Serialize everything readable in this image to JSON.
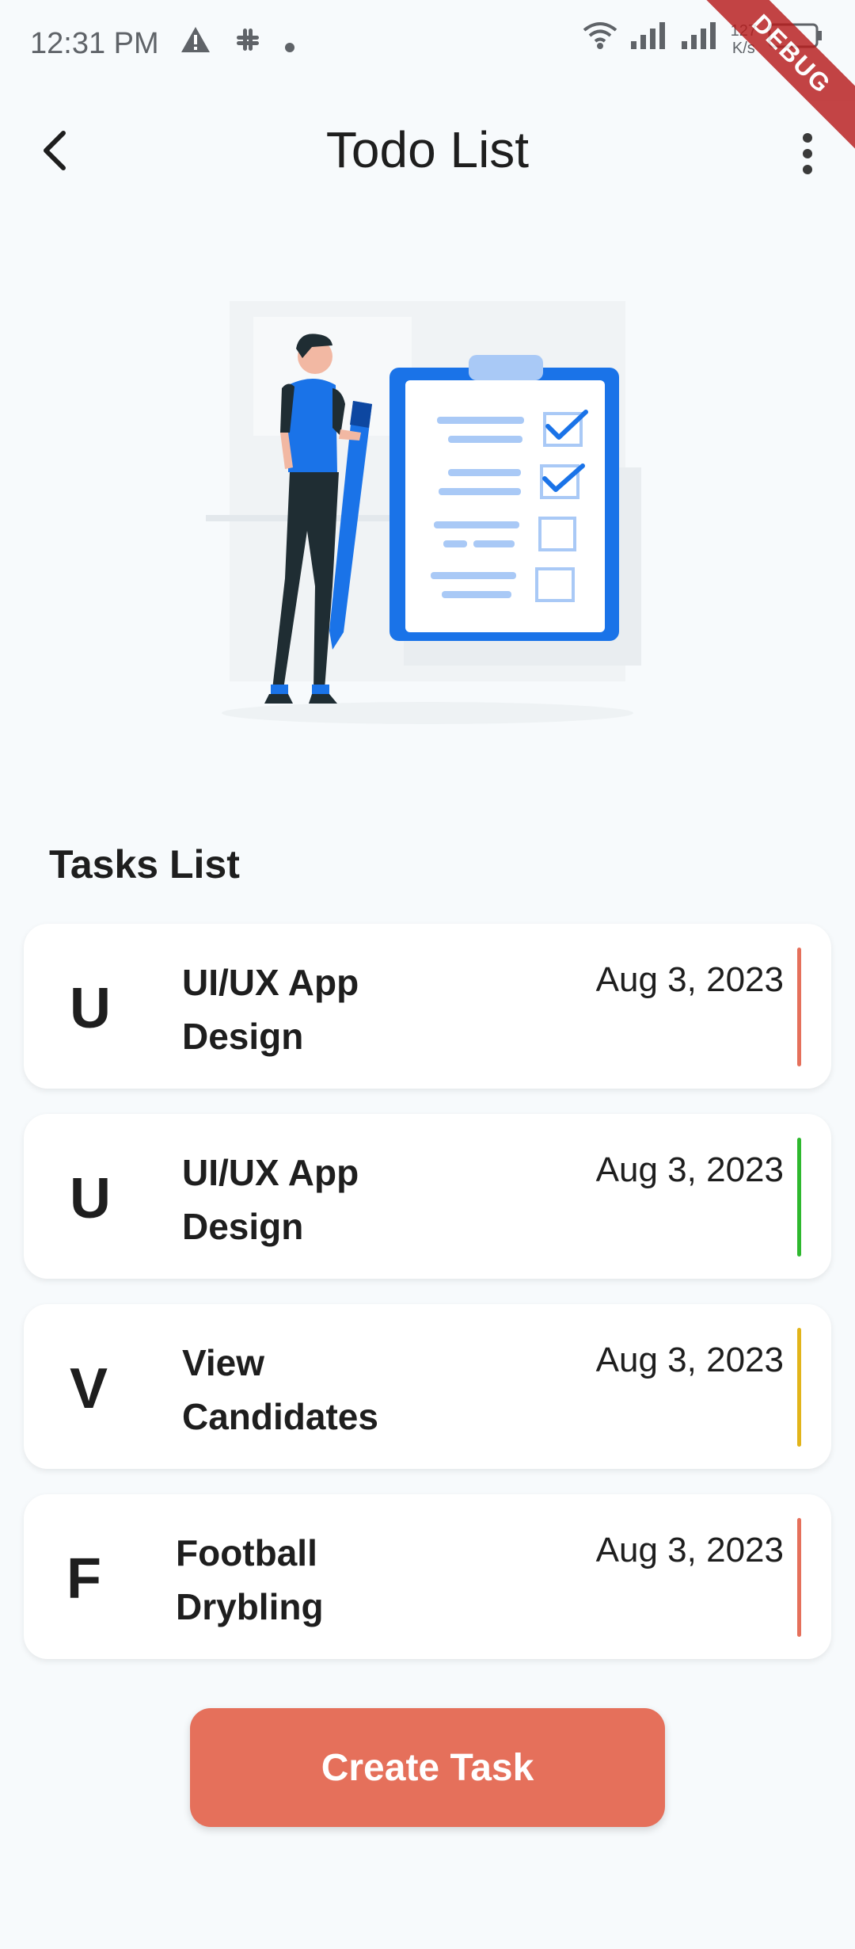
{
  "status_bar": {
    "time": "12:31 PM",
    "net_speed_value": "127",
    "net_speed_unit": "K/s",
    "battery": "44",
    "debug_label": "DEBUG"
  },
  "app_bar": {
    "title": "Todo List",
    "back_icon": "back-arrow-icon",
    "menu_icon": "more-vert-icon"
  },
  "section": {
    "title": "Tasks List"
  },
  "tasks": [
    {
      "initial": "U",
      "title": "UI/UX App Design",
      "date": "Aug 3, 2023",
      "color": "#e5705b"
    },
    {
      "initial": "U",
      "title": "UI/UX App Design",
      "date": "Aug 3, 2023",
      "color": "#2eb82e"
    },
    {
      "initial": "V",
      "title": "View Candidates",
      "date": "Aug 3, 2023",
      "color": "#e2b41a"
    },
    {
      "initial": "F",
      "title": "Football Drybling",
      "date": "Aug 3, 2023",
      "color": "#e5705b"
    }
  ],
  "create_button": {
    "label": "Create Task"
  },
  "colors": {
    "accent": "#e5705b",
    "illustration_blue": "#1a73e8"
  }
}
